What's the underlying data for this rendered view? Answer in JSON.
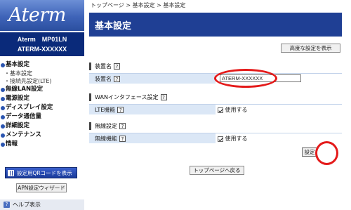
{
  "sidebar": {
    "logo": "Aterm",
    "model_line1": "Aterm　MP01LN",
    "model_line2": "ATERM-XXXXXX",
    "nav": [
      {
        "label": "基本設定",
        "type": "main"
      },
      {
        "label": "・基本設定",
        "type": "sub"
      },
      {
        "label": "・接続先設定(LTE)",
        "type": "sub"
      },
      {
        "label": "無線LAN設定",
        "type": "main"
      },
      {
        "label": "電源設定",
        "type": "main"
      },
      {
        "label": "ディスプレイ設定",
        "type": "main"
      },
      {
        "label": "データ通信量",
        "type": "main"
      },
      {
        "label": "詳細設定",
        "type": "main"
      },
      {
        "label": "メンテナンス",
        "type": "main"
      },
      {
        "label": "情報",
        "type": "main"
      }
    ],
    "qr_button": "設定用QRコードを表示",
    "apn_button": "APN設定ウィザード",
    "help": "ヘルプ表示",
    "help_icon": "?"
  },
  "main": {
    "breadcrumb": "トップページ > 基本設定 > 基本設定",
    "title": "基本設定",
    "advanced_button": "高度な設定を表示",
    "sections": {
      "device_name": {
        "title": "装置名",
        "row_label": "装置名",
        "input_value": "ATERM-XXXXXX"
      },
      "wan": {
        "title": "WANインタフェース設定",
        "row_label": "LTE機能",
        "checkbox_label": "使用する"
      },
      "wireless": {
        "title": "無線設定",
        "row_label": "無線機能",
        "checkbox_label": "使用する"
      }
    },
    "set_button": "設定",
    "top_page_button": "トップページへ戻る",
    "help_mark": "?"
  },
  "colors": {
    "title_bar": "#1f3f94",
    "row_bg": "#dbe7f6",
    "highlight": "#e41a1a"
  }
}
